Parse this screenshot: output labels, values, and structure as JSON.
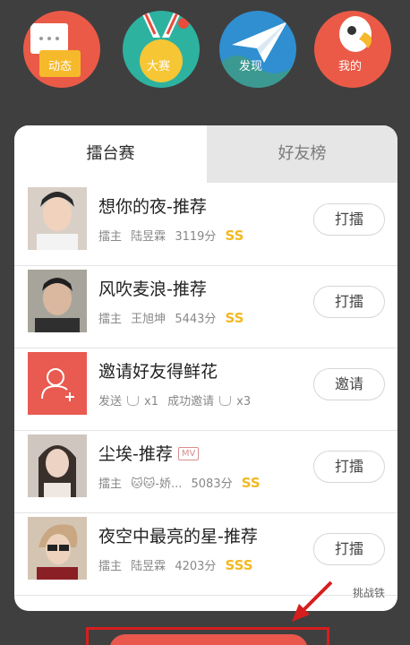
{
  "top_nav": [
    {
      "label": "动态",
      "icon": "chat-bubble-icon"
    },
    {
      "label": "大赛",
      "icon": "medal-icon"
    },
    {
      "label": "发现",
      "icon": "paper-plane-icon"
    },
    {
      "label": "我的",
      "icon": "parrot-icon"
    }
  ],
  "tabs": {
    "active": "擂台赛",
    "inactive": "好友榜"
  },
  "rows": [
    {
      "title": "想你的夜-推荐",
      "role": "擂主",
      "user": "陆昱霖",
      "score": "3119分",
      "rank": "SS",
      "action": "打擂"
    },
    {
      "title": "风吹麦浪-推荐",
      "role": "擂主",
      "user": "王旭坤",
      "score": "5443分",
      "rank": "SS",
      "action": "打擂"
    },
    {
      "title": "邀请好友得鲜花",
      "send": "发送",
      "send_count": "x1",
      "success": "成功邀请",
      "success_count": "x3",
      "action": "邀请"
    },
    {
      "title": "尘埃-推荐",
      "tag": "MV",
      "role": "擂主",
      "user": "🐱🐱-娇...",
      "score": "5083分",
      "rank": "SS",
      "action": "打擂"
    },
    {
      "title": "夜空中最亮的星-推荐",
      "role": "擂主",
      "user": "陆昱霖",
      "score": "4203分",
      "rank": "SSS",
      "action": "打擂"
    }
  ],
  "challenge_link": "挑战铁",
  "colors": {
    "accent_red": "#ea5a47",
    "rank_gold": "#f2b81f",
    "annotation_red": "#d61e1e"
  }
}
